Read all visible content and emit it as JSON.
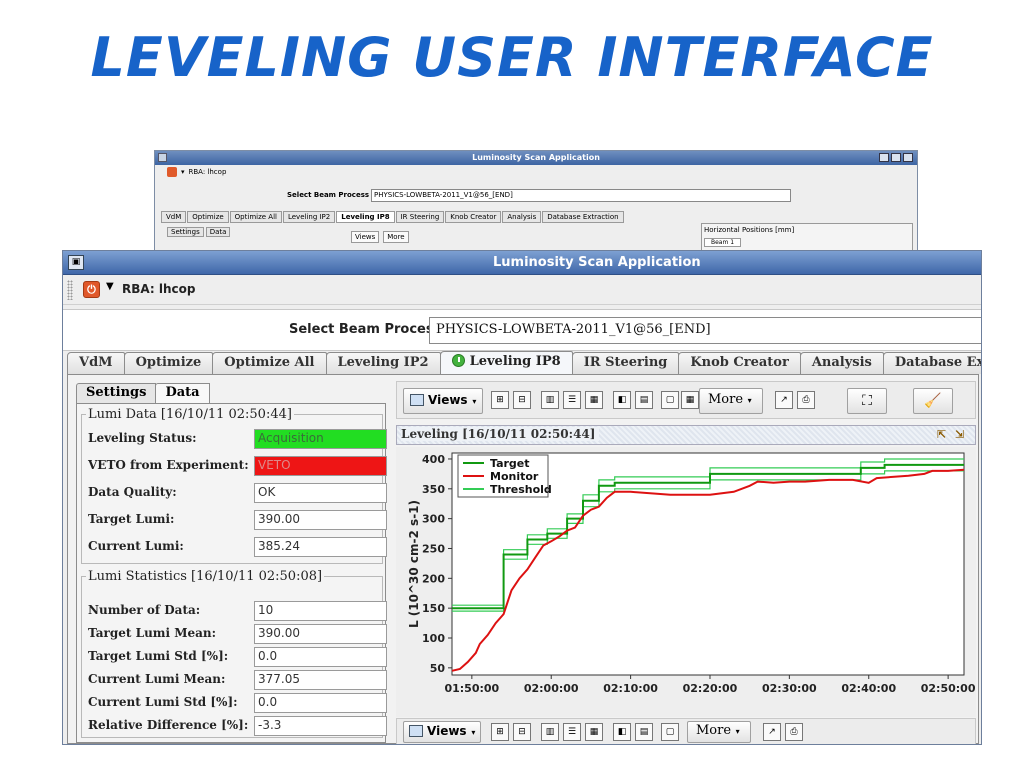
{
  "slide_title": "LEVELING USER INTERFACE",
  "bg_window": {
    "title": "Luminosity Scan Application",
    "rba": "RBA: lhcop",
    "select_label": "Select Beam Process",
    "select_value": "PHYSICS-LOWBETA-2011_V1@56_[END]",
    "tabs": [
      "VdM",
      "Optimize",
      "Optimize All",
      "Leveling IP2",
      "Leveling IP8",
      "IR Steering",
      "Knob Creator",
      "Analysis",
      "Database Extraction"
    ],
    "subtabs": [
      "Settings",
      "Data"
    ],
    "toolbar_views": "Views",
    "toolbar_more": "More",
    "horiz_title": "Horizontal Positions [mm]",
    "beam_label": "Beam 1"
  },
  "window": {
    "title": "Luminosity Scan Application",
    "rba": "RBA: lhcop"
  },
  "select": {
    "label": "Select Beam Process",
    "value": "PHYSICS-LOWBETA-2011_V1@56_[END]"
  },
  "tabs": [
    "VdM",
    "Optimize",
    "Optimize All",
    "Leveling IP2",
    "Leveling IP8",
    "IR Steering",
    "Knob Creator",
    "Analysis",
    "Database Extraction"
  ],
  "active_tab": "Leveling IP8",
  "subtabs": [
    "Settings",
    "Data"
  ],
  "lumi_data": {
    "title": "Lumi Data [16/10/11 02:50:44]",
    "rows": [
      {
        "label": "Leveling Status:",
        "value": "Acquisition",
        "style": "green"
      },
      {
        "label": "VETO from Experiment:",
        "value": "VETO",
        "style": "red"
      },
      {
        "label": "Data Quality:",
        "value": "OK",
        "style": ""
      },
      {
        "label": "Target Lumi:",
        "value": "390.00",
        "style": ""
      },
      {
        "label": "Current Lumi:",
        "value": "385.24",
        "style": ""
      }
    ]
  },
  "lumi_stats": {
    "title": "Lumi Statistics [16/10/11 02:50:08]",
    "rows": [
      {
        "label": "Number of Data:",
        "value": "10"
      },
      {
        "label": "Target Lumi Mean:",
        "value": "390.00"
      },
      {
        "label": "Target Lumi Std [%]:",
        "value": "0.0"
      },
      {
        "label": "Current Lumi Mean:",
        "value": "377.05"
      },
      {
        "label": "Current Lumi Std [%]:",
        "value": "0.0"
      },
      {
        "label": "Relative Difference [%]:",
        "value": "-3.3"
      }
    ]
  },
  "toolbar": {
    "views": "Views",
    "more": "More"
  },
  "chart_header": "Leveling  [16/10/11 02:50:44]",
  "colors": {
    "target": "#119911",
    "monitor": "#dd1111",
    "threshold": "#33cc55",
    "title": "#1763c9"
  },
  "chart_data": {
    "type": "line",
    "ylabel": "L (10^30 cm-2 s-1)",
    "ylim": [
      38,
      410
    ],
    "xlim": [
      "01:47:30",
      "02:52:00"
    ],
    "yticks": [
      50,
      100,
      150,
      200,
      250,
      300,
      350,
      400
    ],
    "xticks": [
      "01:50:00",
      "02:00:00",
      "02:10:00",
      "02:20:00",
      "02:30:00",
      "02:40:00",
      "02:50:00"
    ],
    "legend": [
      "Target",
      "Monitor",
      "Threshold"
    ],
    "legend_position": "top-left",
    "series": [
      {
        "name": "Target",
        "x": [
          "01:47:30",
          "01:54:00",
          "01:54:00",
          "01:57:00",
          "01:57:00",
          "01:59:30",
          "01:59:30",
          "02:02:00",
          "02:02:00",
          "02:04:00",
          "02:04:00",
          "02:06:00",
          "02:06:00",
          "02:08:00",
          "02:08:00",
          "02:20:00",
          "02:20:00",
          "02:39:00",
          "02:39:00",
          "02:42:00",
          "02:42:00",
          "02:52:00"
        ],
        "y": [
          150,
          150,
          240,
          240,
          265,
          265,
          275,
          275,
          300,
          300,
          330,
          330,
          355,
          355,
          360,
          360,
          375,
          375,
          385,
          385,
          390,
          390
        ]
      },
      {
        "name": "Monitor",
        "x": [
          "01:47:30",
          "01:48:30",
          "01:49:30",
          "01:50:30",
          "01:51:00",
          "01:52:00",
          "01:53:00",
          "01:54:00",
          "01:55:00",
          "01:56:00",
          "01:57:00",
          "01:58:00",
          "01:59:00",
          "02:00:00",
          "02:01:00",
          "02:02:00",
          "02:03:00",
          "02:04:00",
          "02:05:00",
          "02:06:00",
          "02:07:00",
          "02:08:00",
          "02:10:00",
          "02:15:00",
          "02:20:00",
          "02:23:00",
          "02:25:00",
          "02:26:00",
          "02:28:00",
          "02:30:00",
          "02:32:00",
          "02:35:00",
          "02:38:00",
          "02:40:00",
          "02:41:00",
          "02:43:00",
          "02:45:00",
          "02:47:00",
          "02:48:00",
          "02:50:00",
          "02:52:00"
        ],
        "y": [
          45,
          48,
          60,
          75,
          90,
          105,
          125,
          140,
          180,
          200,
          215,
          235,
          255,
          262,
          270,
          280,
          285,
          305,
          315,
          320,
          335,
          345,
          345,
          340,
          340,
          345,
          355,
          362,
          360,
          362,
          362,
          365,
          365,
          360,
          368,
          370,
          372,
          375,
          380,
          380,
          382
        ]
      },
      {
        "name": "Threshold upper",
        "x": [
          "01:47:30",
          "01:54:00",
          "01:54:00",
          "01:57:00",
          "01:57:00",
          "01:59:30",
          "01:59:30",
          "02:02:00",
          "02:02:00",
          "02:04:00",
          "02:04:00",
          "02:06:00",
          "02:06:00",
          "02:08:00",
          "02:08:00",
          "02:20:00",
          "02:20:00",
          "02:39:00",
          "02:39:00",
          "02:42:00",
          "02:42:00",
          "02:52:00"
        ],
        "y": [
          155,
          155,
          248,
          248,
          273,
          273,
          283,
          283,
          308,
          308,
          340,
          340,
          365,
          365,
          370,
          370,
          385,
          385,
          395,
          395,
          400,
          400
        ]
      },
      {
        "name": "Threshold lower",
        "x": [
          "01:47:30",
          "01:54:00",
          "01:54:00",
          "01:57:00",
          "01:57:00",
          "01:59:30",
          "01:59:30",
          "02:02:00",
          "02:02:00",
          "02:04:00",
          "02:04:00",
          "02:06:00",
          "02:06:00",
          "02:08:00",
          "02:08:00",
          "02:20:00",
          "02:20:00",
          "02:39:00",
          "02:39:00",
          "02:42:00",
          "02:42:00",
          "02:52:00"
        ],
        "y": [
          145,
          145,
          232,
          232,
          257,
          257,
          267,
          267,
          292,
          292,
          320,
          320,
          345,
          345,
          350,
          350,
          365,
          365,
          375,
          375,
          380,
          380
        ]
      }
    ]
  }
}
